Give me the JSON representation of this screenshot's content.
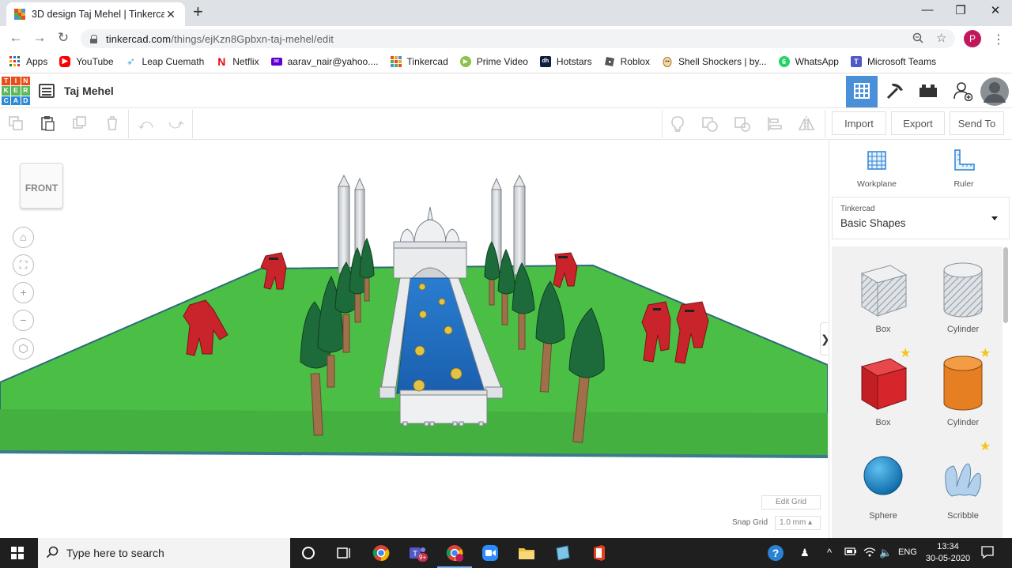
{
  "browser": {
    "tab_title": "3D design Taj Mehel | Tinkercad",
    "tab_close": "✕",
    "new_tab": "+",
    "window_controls": {
      "minimize": "—",
      "maximize": "❐",
      "close": "✕"
    },
    "url_host": "tinkercad.com",
    "url_path": "/things/ejKzn8Gpbxn-taj-mehel/edit",
    "profile_initial": "P"
  },
  "bookmarks": [
    {
      "label": "Apps",
      "icon": "apps-grid-icon"
    },
    {
      "label": "YouTube",
      "icon": "youtube-icon",
      "color": "#ff0000"
    },
    {
      "label": "Leap Cuemath",
      "icon": "rocket-icon",
      "color": "#4fa3e0"
    },
    {
      "label": "Netflix",
      "icon": "netflix-icon",
      "color": "#e50914"
    },
    {
      "label": "aarav_nair@yahoo....",
      "icon": "yahoo-mail-icon",
      "color": "#6001d2"
    },
    {
      "label": "Tinkercad",
      "icon": "tinkercad-icon",
      "color": "#e84e1b"
    },
    {
      "label": "Prime Video",
      "icon": "play-icon",
      "color": "#8bc34a"
    },
    {
      "label": "Hotstars",
      "icon": "hotstar-icon",
      "color": "#0f1e3c"
    },
    {
      "label": "Roblox",
      "icon": "roblox-icon",
      "color": "#555555"
    },
    {
      "label": "Shell Shockers | by...",
      "icon": "egg-icon",
      "color": "#d9a441"
    },
    {
      "label": "WhatsApp",
      "icon": "whatsapp-icon",
      "color": "#25d366"
    },
    {
      "label": "Microsoft Teams",
      "icon": "teams-icon",
      "color": "#5059c9"
    }
  ],
  "tinkercad": {
    "logo_letters": [
      "TIN",
      "KER",
      "CAD"
    ],
    "design_title": "Taj Mehel",
    "toolbar_buttons": {
      "import": "Import",
      "export": "Export",
      "send_to": "Send To"
    },
    "viewcube_label": "FRONT",
    "edit_grid": "Edit Grid",
    "snap_grid_label": "Snap Grid",
    "snap_grid_value": "1.0 mm ▴",
    "collapse_arrow": "❯"
  },
  "right_panel": {
    "tools": [
      {
        "label": "Workplane",
        "icon": "workplane-icon"
      },
      {
        "label": "Ruler",
        "icon": "ruler-icon"
      }
    ],
    "library_small": "Tinkercad",
    "library_name": "Basic Shapes",
    "shapes": [
      {
        "name": "Box",
        "icon": "box-hole-icon",
        "starred": false
      },
      {
        "name": "Cylinder",
        "icon": "cylinder-hole-icon",
        "starred": false
      },
      {
        "name": "Box",
        "icon": "box-solid-icon",
        "starred": true,
        "color": "#d7262b"
      },
      {
        "name": "Cylinder",
        "icon": "cylinder-solid-icon",
        "starred": true,
        "color": "#e67e22"
      },
      {
        "name": "Sphere",
        "icon": "sphere-icon",
        "starred": false,
        "color": "#1a8fd1"
      },
      {
        "name": "Scribble",
        "icon": "scribble-icon",
        "starred": true,
        "color": "#a8c8e8"
      }
    ]
  },
  "taskbar": {
    "search_placeholder": "Type here to search",
    "language": "ENG",
    "time": "13:34",
    "date": "30-05-2020",
    "teams_badge": "9+"
  }
}
